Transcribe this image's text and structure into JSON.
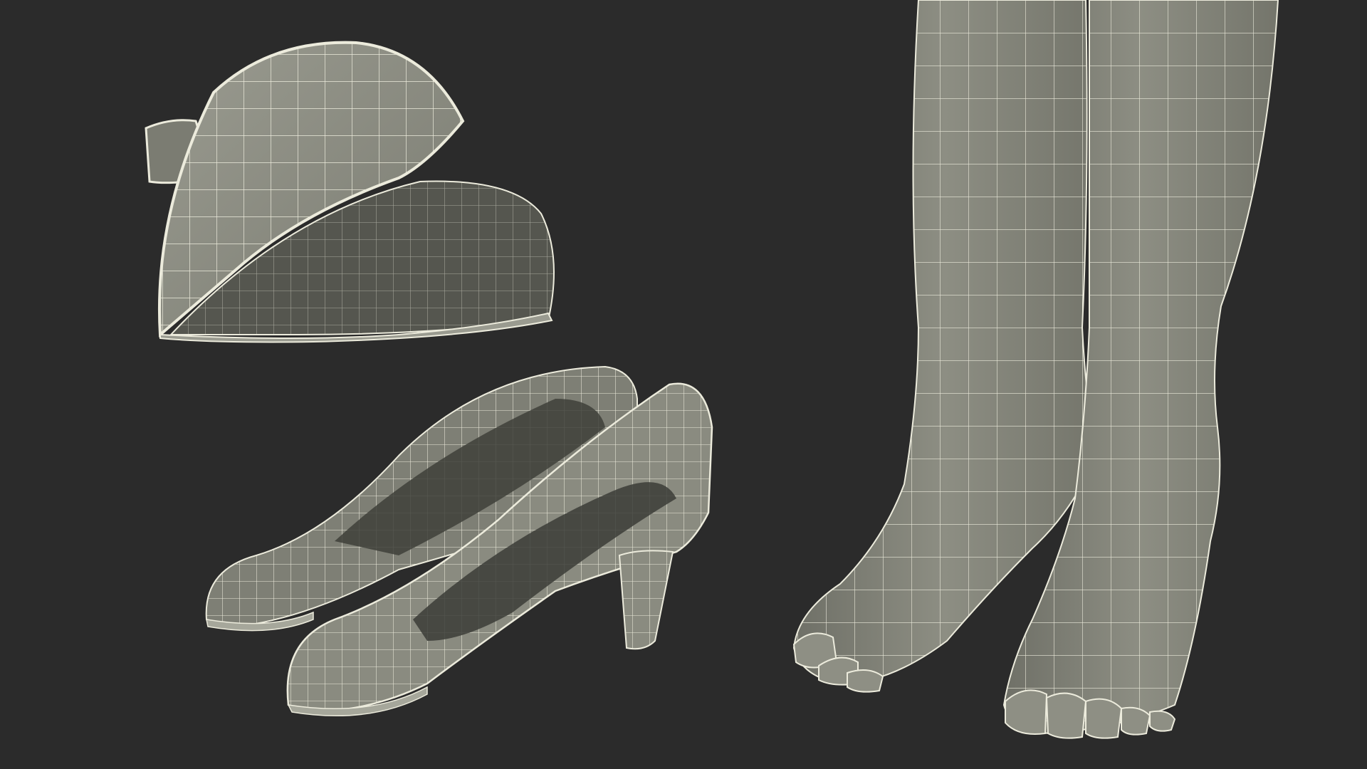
{
  "scene": {
    "background": "#2b2b2b",
    "mesh_fill": "#8a8b80",
    "mesh_fill_shadow": "#6d6e64",
    "mesh_fill_dark": "#555650",
    "wire_color": "#ecebdc"
  },
  "objects": [
    {
      "name": "garrison-cap"
    },
    {
      "name": "high-heel-pumps"
    },
    {
      "name": "legs-and-feet"
    }
  ]
}
